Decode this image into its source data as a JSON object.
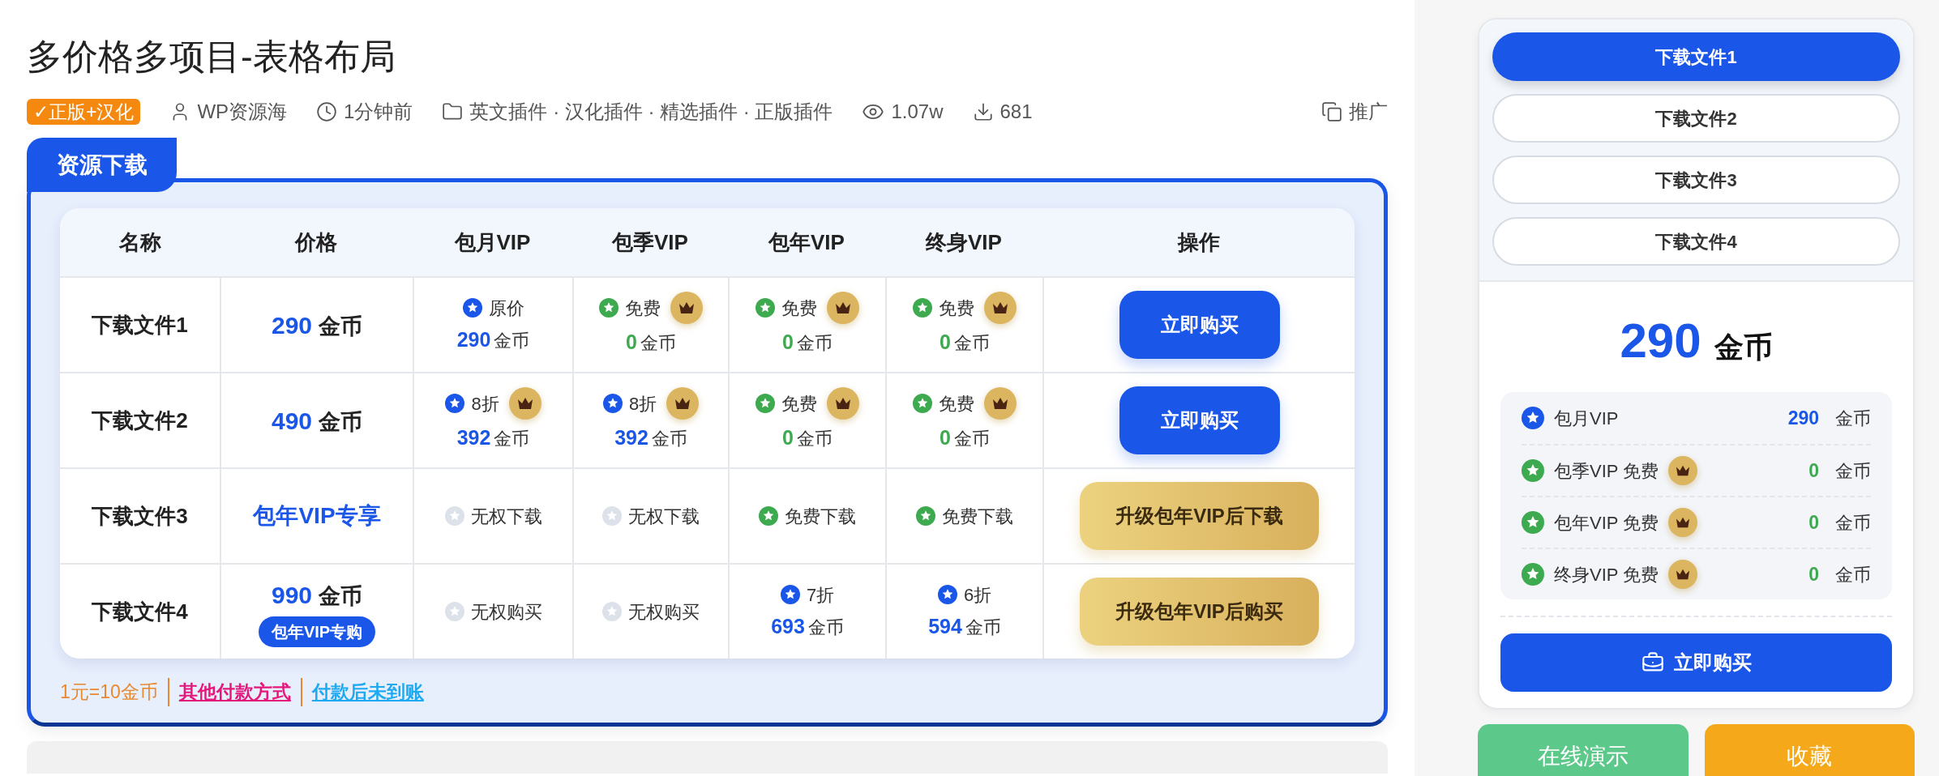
{
  "title": "多价格多项目-表格布局",
  "meta": {
    "tag": "✓正版+汉化",
    "author": "WP资源海",
    "time": "1分钟前",
    "categories": "英文插件 · 汉化插件 · 精选插件 · 正版插件",
    "views": "1.07w",
    "downloads": "681",
    "share": "推广"
  },
  "resource": {
    "heading": "资源下载",
    "columns": [
      "名称",
      "价格",
      "包月VIP",
      "包季VIP",
      "包年VIP",
      "终身VIP",
      "操作"
    ],
    "rows": [
      {
        "name": "下载文件1",
        "price": {
          "kind": "amount",
          "amount": "290",
          "unit": "金币"
        },
        "vip": [
          {
            "kind": "offer",
            "color": "#1a56e8",
            "label": "原价",
            "crown": false,
            "amount": "290",
            "unit": "金币"
          },
          {
            "kind": "offer",
            "color": "#3daa4f",
            "label": "免费",
            "crown": true,
            "amount": "0",
            "unit": "金币"
          },
          {
            "kind": "offer",
            "color": "#3daa4f",
            "label": "免费",
            "crown": true,
            "amount": "0",
            "unit": "金币"
          },
          {
            "kind": "offer",
            "color": "#3daa4f",
            "label": "免费",
            "crown": true,
            "amount": "0",
            "unit": "金币"
          }
        ],
        "action": {
          "kind": "primary",
          "label": "立即购买"
        }
      },
      {
        "name": "下载文件2",
        "price": {
          "kind": "amount",
          "amount": "490",
          "unit": "金币"
        },
        "vip": [
          {
            "kind": "offer",
            "color": "#1a56e8",
            "label": "8折",
            "crown": true,
            "amount": "392",
            "unit": "金币"
          },
          {
            "kind": "offer",
            "color": "#1a56e8",
            "label": "8折",
            "crown": true,
            "amount": "392",
            "unit": "金币"
          },
          {
            "kind": "offer",
            "color": "#3daa4f",
            "label": "免费",
            "crown": true,
            "amount": "0",
            "unit": "金币"
          },
          {
            "kind": "offer",
            "color": "#3daa4f",
            "label": "免费",
            "crown": true,
            "amount": "0",
            "unit": "金币"
          }
        ],
        "action": {
          "kind": "primary",
          "label": "立即购买"
        }
      },
      {
        "name": "下载文件3",
        "price": {
          "kind": "exclusive",
          "text": "包年VIP专享"
        },
        "vip": [
          {
            "kind": "access",
            "allowed": false,
            "text": "无权下载"
          },
          {
            "kind": "access",
            "allowed": false,
            "text": "无权下载"
          },
          {
            "kind": "access",
            "allowed": true,
            "text": "免费下载"
          },
          {
            "kind": "access",
            "allowed": true,
            "text": "免费下载"
          }
        ],
        "action": {
          "kind": "gold",
          "label": "升级包年VIP后下载"
        }
      },
      {
        "name": "下载文件4",
        "price": {
          "kind": "amount",
          "amount": "990",
          "unit": "金币",
          "tag": "包年VIP专购"
        },
        "vip": [
          {
            "kind": "access",
            "allowed": false,
            "text": "无权购买"
          },
          {
            "kind": "access",
            "allowed": false,
            "text": "无权购买"
          },
          {
            "kind": "offer",
            "color": "#1a56e8",
            "label": "7折",
            "crown": false,
            "amount": "693",
            "unit": "金币"
          },
          {
            "kind": "offer",
            "color": "#1a56e8",
            "label": "6折",
            "crown": false,
            "amount": "594",
            "unit": "金币"
          }
        ],
        "action": {
          "kind": "gold",
          "label": "升级包年VIP后购买"
        }
      }
    ],
    "footer": [
      {
        "kind": "text",
        "text": "1元=10金币",
        "color": "#e8892f"
      },
      {
        "kind": "link",
        "text": "其他付款方式",
        "color": "#e5177b"
      },
      {
        "kind": "link",
        "text": "付款后未到账",
        "color": "#1eaaf1"
      }
    ]
  },
  "sidebar": {
    "tabs": [
      {
        "label": "下载文件1",
        "selected": true
      },
      {
        "label": "下载文件2",
        "selected": false
      },
      {
        "label": "下载文件3",
        "selected": false
      },
      {
        "label": "下载文件4",
        "selected": false
      }
    ],
    "price": {
      "amount": "290",
      "unit": "金币"
    },
    "items": [
      {
        "color": "#1a56e8",
        "label": "包月VIP",
        "crown": false,
        "amount": "290",
        "unit": "金币"
      },
      {
        "color": "#3daa4f",
        "label": "包季VIP 免费",
        "crown": true,
        "amount": "0",
        "unit": "金币"
      },
      {
        "color": "#3daa4f",
        "label": "包年VIP 免费",
        "crown": true,
        "amount": "0",
        "unit": "金币"
      },
      {
        "color": "#3daa4f",
        "label": "终身VIP 免费",
        "crown": true,
        "amount": "0",
        "unit": "金币"
      }
    ],
    "buy": "立即购买",
    "demo": "在线演示",
    "favorite": "收藏"
  }
}
